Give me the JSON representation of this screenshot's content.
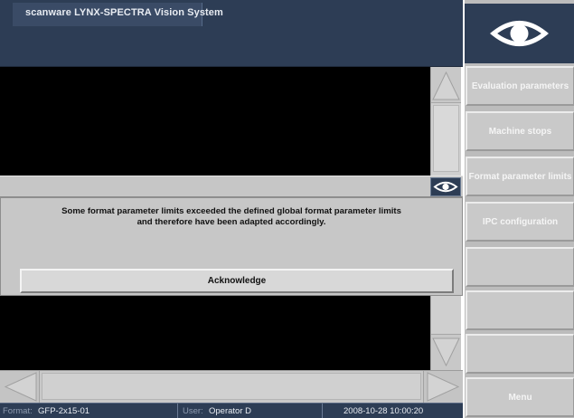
{
  "window": {
    "title": "scanware LYNX-SPECTRA Vision System"
  },
  "dialog": {
    "message_line1": "Some format parameter limits exceeded the defined global format parameter limits",
    "message_line2": "and therefore have been adapted accordingly.",
    "acknowledge_label": "Acknowledge"
  },
  "sidebar": {
    "buttons": [
      {
        "label": "Evaluation parameters"
      },
      {
        "label": "Machine stops"
      },
      {
        "label": "Format parameter limits"
      },
      {
        "label": "IPC configuration"
      },
      {
        "label": ""
      },
      {
        "label": ""
      },
      {
        "label": ""
      }
    ],
    "menu_label": "Menu"
  },
  "statusbar": {
    "format_key": "Format:",
    "format_value": "GFP-2x15-01",
    "user_key": "User:",
    "user_value": "Operator D",
    "datetime": "2008-10-28 10:00:20"
  },
  "colors": {
    "dark_blue": "#2d3d55",
    "panel_gray": "#c7c7c7"
  },
  "icons": [
    "eye-logo-icon",
    "eye-small-icon",
    "arrow-up-icon",
    "arrow-down-icon",
    "arrow-left-icon",
    "arrow-right-icon"
  ]
}
